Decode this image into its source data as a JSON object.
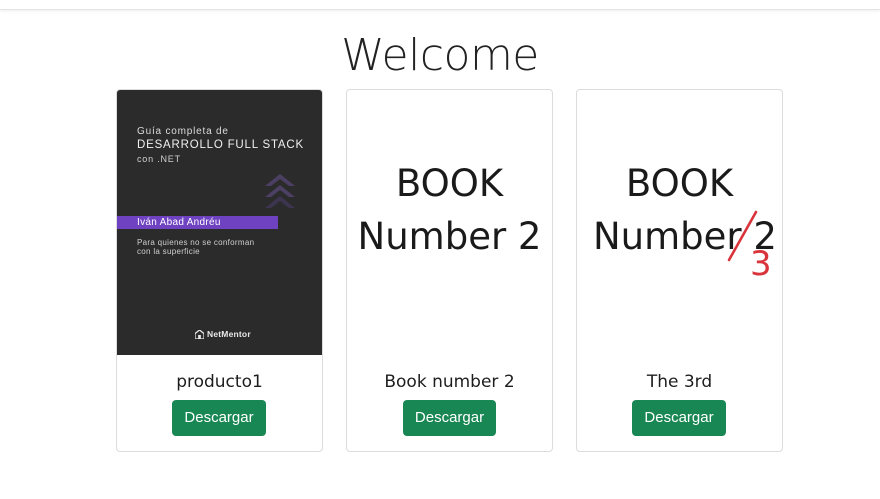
{
  "page": {
    "title": "Welcome"
  },
  "products": [
    {
      "name": "producto1",
      "button_label": "Descargar",
      "cover": {
        "line1": "Guía completa de",
        "line2": "DESARROLLO FULL STACK",
        "line3": "con .NET",
        "author": "Iván Abad Andréu",
        "subtitle1": "Para quienes no se conforman",
        "subtitle2": "con la superficie",
        "logo": "NetMentor",
        "background": "#2b2b2b",
        "accent": "#6f42c1"
      }
    },
    {
      "name": "Book number 2",
      "button_label": "Descargar",
      "cover": {
        "line1": "BOOK",
        "line2": "Number 2"
      }
    },
    {
      "name": "The 3rd",
      "button_label": "Descargar",
      "cover": {
        "line1": "BOOK",
        "line2_prefix": "Number ",
        "line2_struck": "2",
        "correction": "3",
        "correction_color": "#d9343c"
      }
    }
  ],
  "colors": {
    "button": "#198754",
    "button_text": "#ffffff"
  }
}
